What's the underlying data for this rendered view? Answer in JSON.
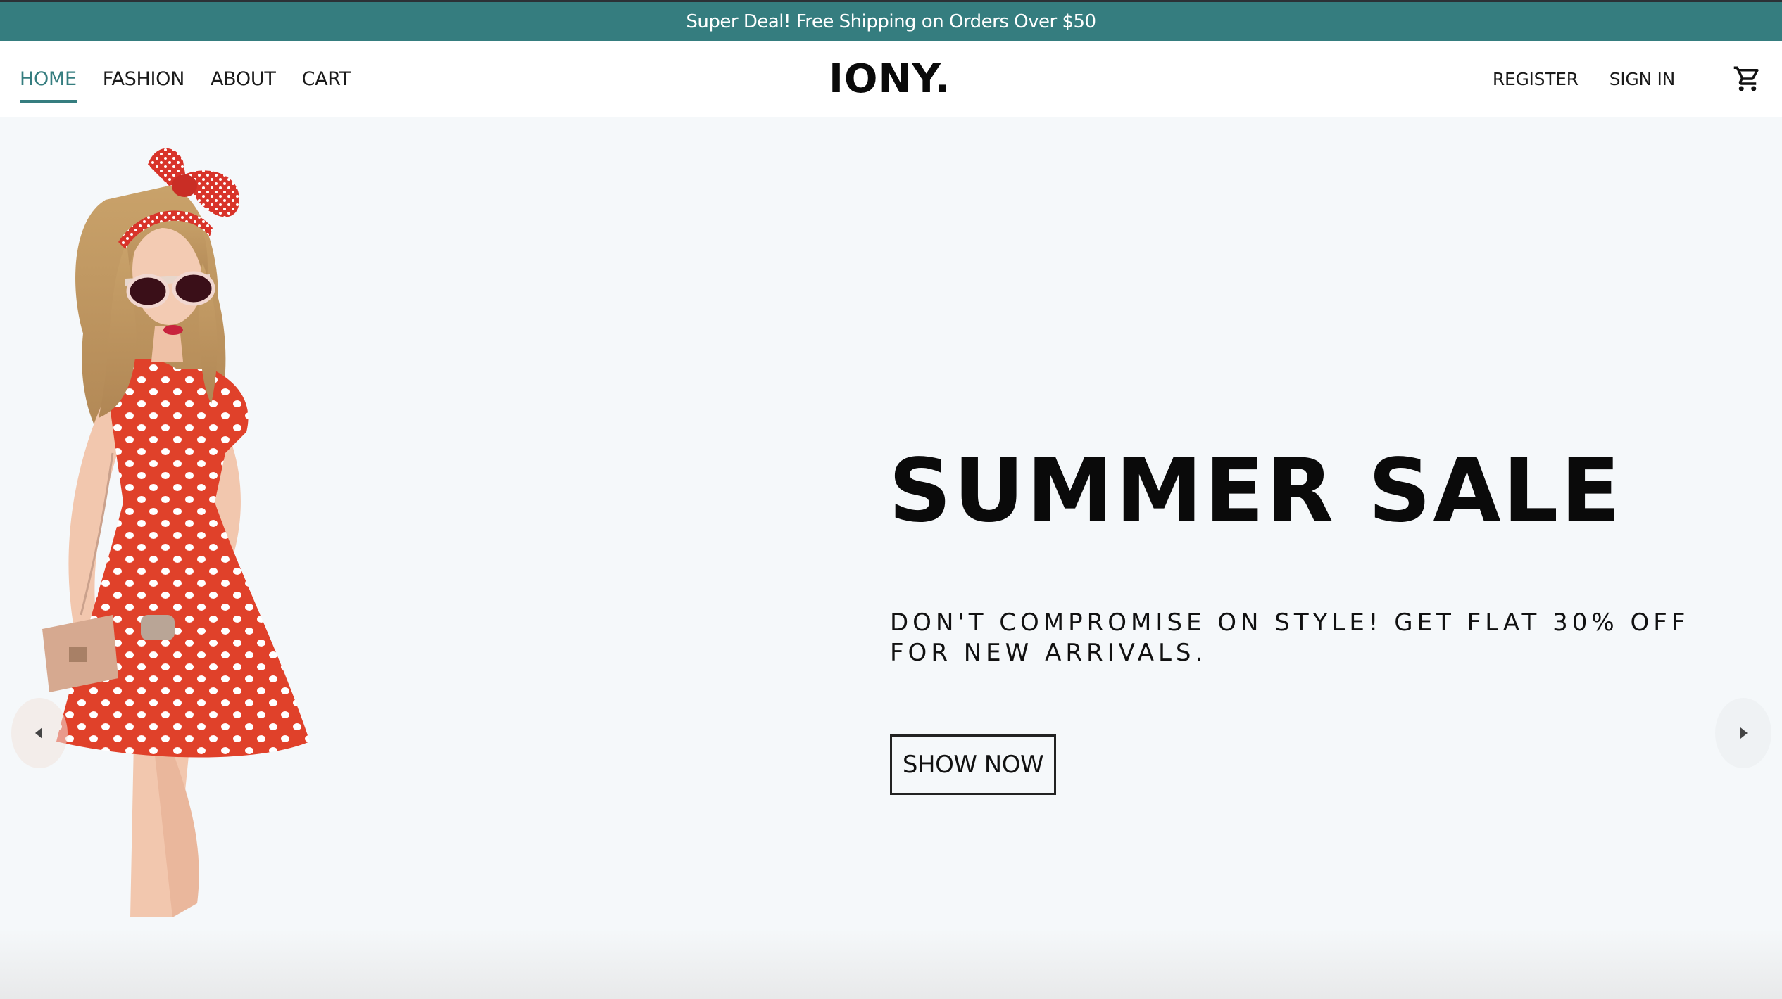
{
  "announcement": {
    "text": "Super Deal! Free Shipping on Orders Over $50"
  },
  "nav": {
    "left": [
      "HOME",
      "FASHION",
      "ABOUT",
      "CART"
    ],
    "active": "HOME",
    "logo": "IONY.",
    "right": [
      "REGISTER",
      "SIGN IN"
    ],
    "cart_icon": "shopping-cart-icon"
  },
  "hero": {
    "title": "SUMMER SALE",
    "subtitle": "DON'T COMPROMISE ON STYLE! GET FLAT 30% OFF FOR NEW ARRIVALS.",
    "cta": "SHOW NOW",
    "prev_icon": "caret-left-icon",
    "next_icon": "caret-right-icon"
  },
  "colors": {
    "accent": "#357d7f",
    "hero_bg": "#f5f8fa",
    "dress": "#e0412a"
  }
}
